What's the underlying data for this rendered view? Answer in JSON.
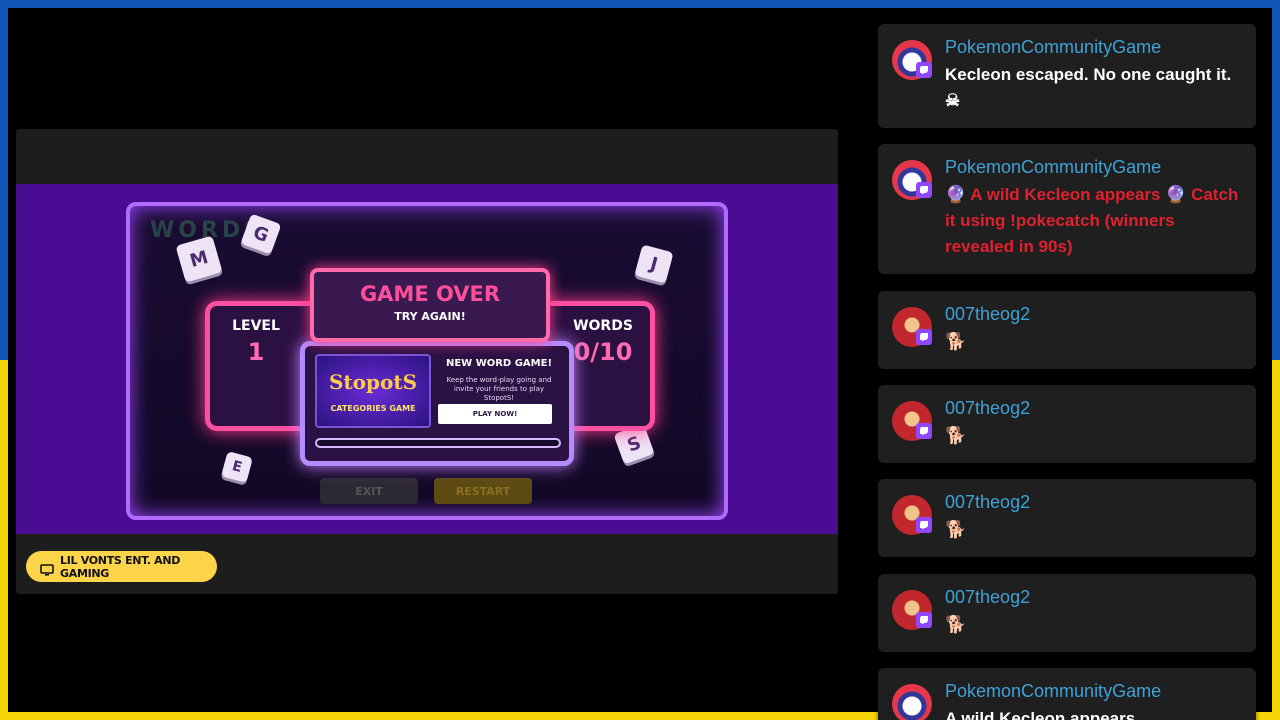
{
  "stream": {
    "game": {
      "ghost_title": "WORDS",
      "dice": [
        "G",
        "M",
        "J",
        "S",
        "E"
      ],
      "ghost_buttons": [
        "EXIT",
        "RESTART"
      ],
      "game_over_title": "GAME OVER",
      "game_over_subtitle": "TRY AGAIN!",
      "level_label": "LEVEL",
      "level_value": "1",
      "words_label": "WORDS",
      "words_value": "0/10",
      "promo": {
        "brand": "StopotS",
        "tag": "CATEGORIES GAME",
        "heading": "NEW WORD GAME!",
        "text": "Keep the word-play going and invite your friends to play StopotS!",
        "button": "PLAY NOW!"
      }
    },
    "channel_label": "LIL VONTS ENT. AND GAMING"
  },
  "chat": {
    "messages": [
      {
        "user": "PokemonCommunityGame",
        "text": "Kecleon escaped. No one caught it.",
        "emote": "☠",
        "avatar": "poke-avatar",
        "alert": false
      },
      {
        "user": "PokemonCommunityGame",
        "text": "🔮 A wild Kecleon appears 🔮 Catch it using !pokecatch (winners revealed in 90s)",
        "avatar": "poke-avatar",
        "alert": true
      },
      {
        "user": "007theog2",
        "text": "🐕",
        "avatar": "user-avatar",
        "alert": false
      },
      {
        "user": "007theog2",
        "text": "🐕",
        "avatar": "user-avatar",
        "alert": false
      },
      {
        "user": "007theog2",
        "text": "🐕",
        "avatar": "user-avatar",
        "alert": false
      },
      {
        "user": "007theog2",
        "text": "🐕",
        "avatar": "user-avatar",
        "alert": false
      },
      {
        "user": "PokemonCommunityGame",
        "text": "A wild Kecleon appears...",
        "avatar": "poke-avatar",
        "alert": false
      }
    ]
  },
  "colors": {
    "flag_blue": "#1356b8",
    "flag_yellow": "#f5d50a",
    "username_blue": "#3ea2d8",
    "alert_red": "#e0202e",
    "game_purple": "#4a0c92",
    "badge_yellow": "#fbd44a"
  }
}
